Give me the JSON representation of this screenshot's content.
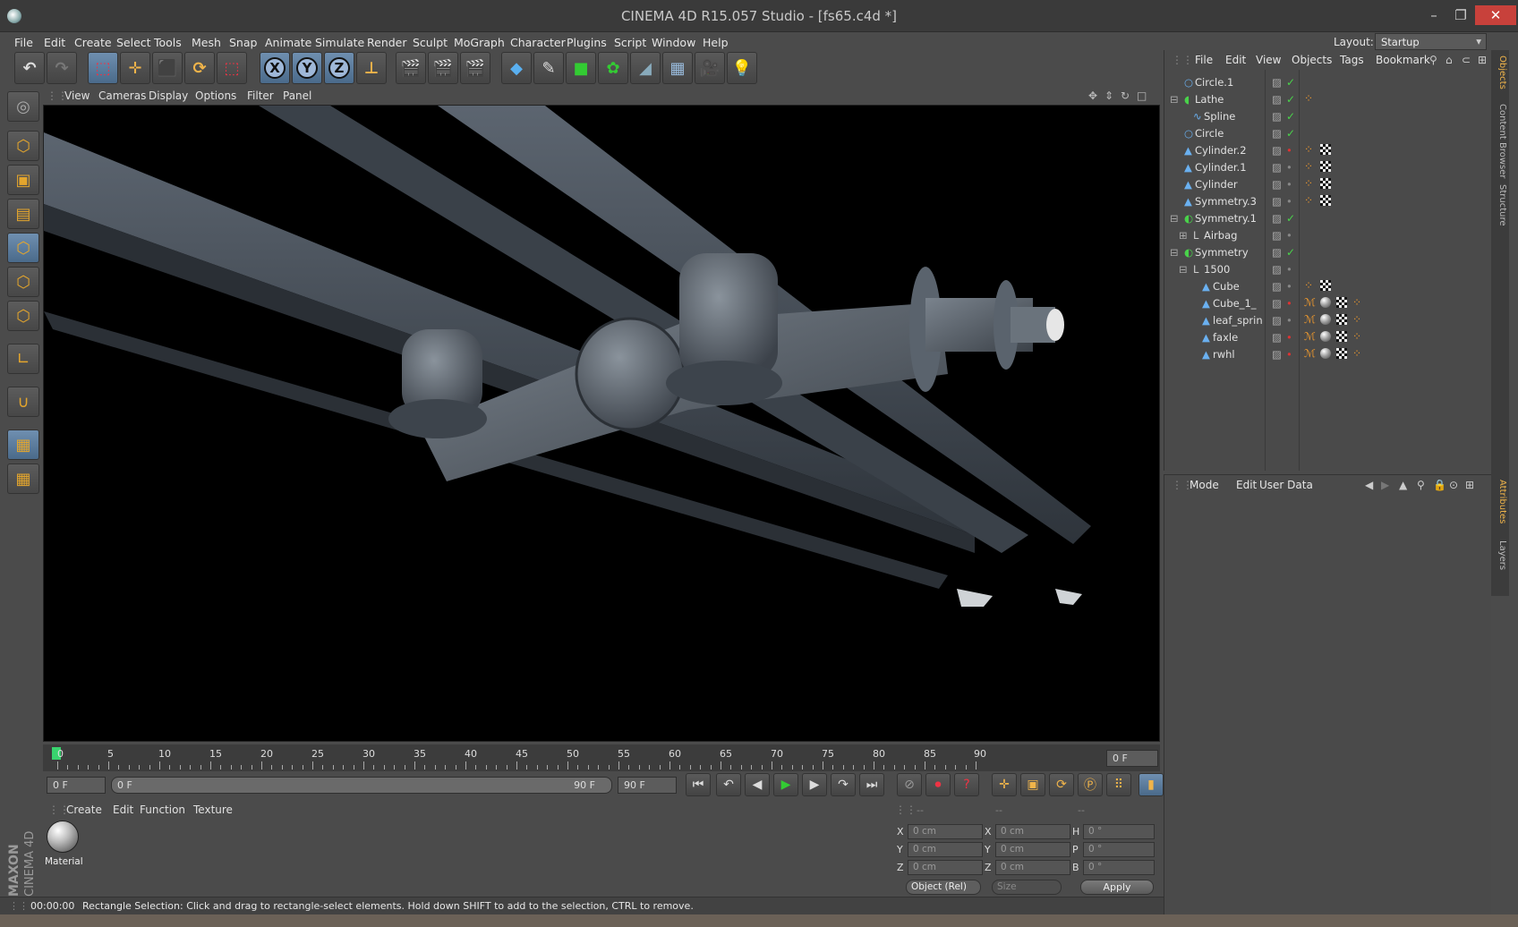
{
  "window": {
    "title": "CINEMA 4D R15.057 Studio - [fs65.c4d *]",
    "minimize": "–",
    "maximize": "❐",
    "close": "✕"
  },
  "menu": [
    "File",
    "Edit",
    "Create",
    "Select",
    "Tools",
    "Mesh",
    "Snap",
    "Animate",
    "Simulate",
    "Render",
    "Sculpt",
    "MoGraph",
    "Character",
    "Plugins",
    "Script",
    "Window",
    "Help"
  ],
  "layout": {
    "label": "Layout:",
    "value": "Startup"
  },
  "viewport_menu": [
    "View",
    "Cameras",
    "Display",
    "Options",
    "Filter",
    "Panel"
  ],
  "timeline": {
    "ticks": [
      "0",
      "5",
      "10",
      "15",
      "20",
      "25",
      "30",
      "35",
      "40",
      "45",
      "50",
      "55",
      "60",
      "65",
      "70",
      "75",
      "80",
      "85",
      "90"
    ],
    "current_frame": "0 F"
  },
  "controls": {
    "start_frame": "0 F",
    "range_start": "0 F",
    "range_end": "90 F",
    "end_frame": "90 F"
  },
  "material_menu": [
    "Create",
    "Edit",
    "Function",
    "Texture"
  ],
  "material": {
    "name": "Material"
  },
  "coords": {
    "headers": [
      "--",
      "--",
      "--"
    ],
    "rows": [
      {
        "a": "X",
        "av": "0 cm",
        "b": "X",
        "bv": "0 cm",
        "c": "H",
        "cv": "0 °"
      },
      {
        "a": "Y",
        "av": "0 cm",
        "b": "Y",
        "bv": "0 cm",
        "c": "P",
        "cv": "0 °"
      },
      {
        "a": "Z",
        "av": "0 cm",
        "b": "Z",
        "bv": "0 cm",
        "c": "B",
        "cv": "0 °"
      }
    ],
    "mode": "Object (Rel)",
    "size": "Size",
    "apply": "Apply"
  },
  "status": {
    "time": "00:00:00",
    "message": "Rectangle Selection: Click and drag to rectangle-select elements. Hold down SHIFT to add to the selection, CTRL to remove."
  },
  "objects_menu": [
    "File",
    "Edit",
    "View",
    "Objects",
    "Tags",
    "Bookmark"
  ],
  "objects": [
    {
      "name": "Circle.1"
    },
    {
      "name": "Lathe"
    },
    {
      "name": "Spline"
    },
    {
      "name": "Circle"
    },
    {
      "name": "Cylinder.2"
    },
    {
      "name": "Cylinder.1"
    },
    {
      "name": "Cylinder"
    },
    {
      "name": "Symmetry.3"
    },
    {
      "name": "Symmetry.1"
    },
    {
      "name": "Airbag"
    },
    {
      "name": "Symmetry"
    },
    {
      "name": "1500"
    },
    {
      "name": "Cube"
    },
    {
      "name": "Cube_1_"
    },
    {
      "name": "leaf_sprin"
    },
    {
      "name": "faxle"
    },
    {
      "name": "rwhl"
    }
  ],
  "attributes_menu": [
    "Mode",
    "Edit",
    "User Data"
  ],
  "side_tabs_top": [
    "Objects",
    "Content Browser",
    "Structure"
  ],
  "side_tabs_bottom": [
    "Attributes",
    "Layers"
  ],
  "colors": {
    "accent": "#f0b44a",
    "check": "#49d24a",
    "close": "#c8413b"
  },
  "logo": {
    "line1": "MAXON",
    "line2": "CINEMA 4D"
  }
}
